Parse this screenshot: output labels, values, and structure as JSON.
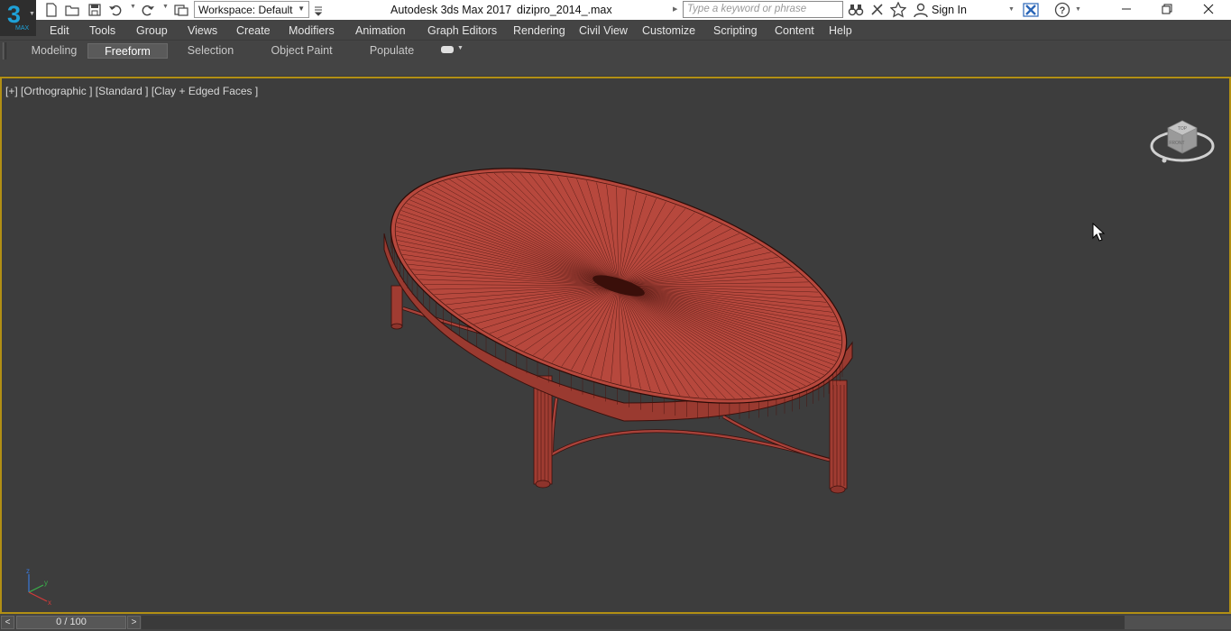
{
  "titlebar": {
    "workspace_label": "Workspace: Default",
    "app_title": "Autodesk 3ds Max 2017",
    "file_name": "dizipro_2014_.max",
    "search_placeholder": "Type a keyword or phrase",
    "sign_in_label": "Sign In"
  },
  "menu": {
    "items": [
      "Edit",
      "Tools",
      "Group",
      "Views",
      "Create",
      "Modifiers",
      "Animation",
      "Graph Editors",
      "Rendering",
      "Civil View",
      "Customize",
      "Scripting",
      "Content",
      "Help"
    ]
  },
  "ribbon": {
    "tabs": [
      "Modeling",
      "Freeform",
      "Selection",
      "Object Paint",
      "Populate"
    ],
    "active_tab": "Freeform"
  },
  "viewport": {
    "label_plus": "[+]",
    "label_view": "[Orthographic ]",
    "label_shading_std": "[Standard ]",
    "label_shading": "[Clay + Edged Faces ]",
    "border_color": "#b28f14",
    "object_color": "#b7483d",
    "background_color": "#3d3d3d"
  },
  "viewcube": {
    "top_label": "TOP",
    "front_label": "FRONT"
  },
  "timeline": {
    "frame_display": "0 / 100",
    "prev_label": "<",
    "next_label": ">"
  }
}
